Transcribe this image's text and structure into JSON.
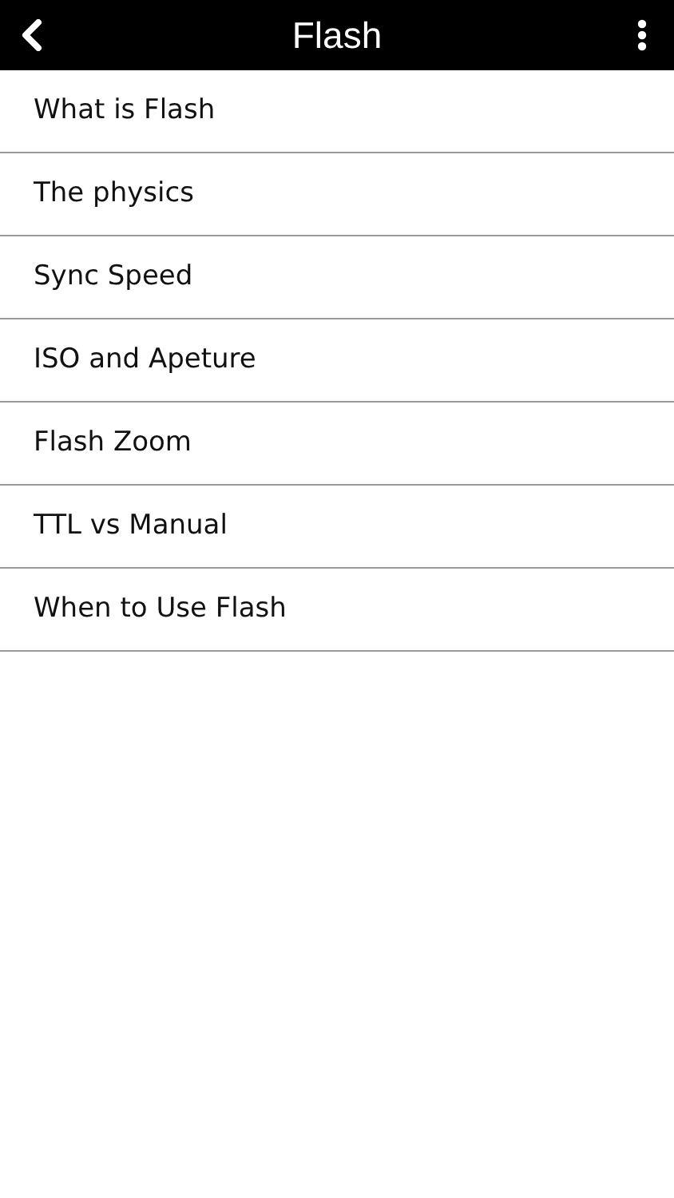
{
  "header": {
    "title": "Flash"
  },
  "items": [
    {
      "label": "What is Flash"
    },
    {
      "label": "The physics"
    },
    {
      "label": "Sync Speed"
    },
    {
      "label": "ISO and Apeture"
    },
    {
      "label": "Flash Zoom"
    },
    {
      "label": "TTL vs Manual"
    },
    {
      "label": "When to Use Flash"
    }
  ]
}
